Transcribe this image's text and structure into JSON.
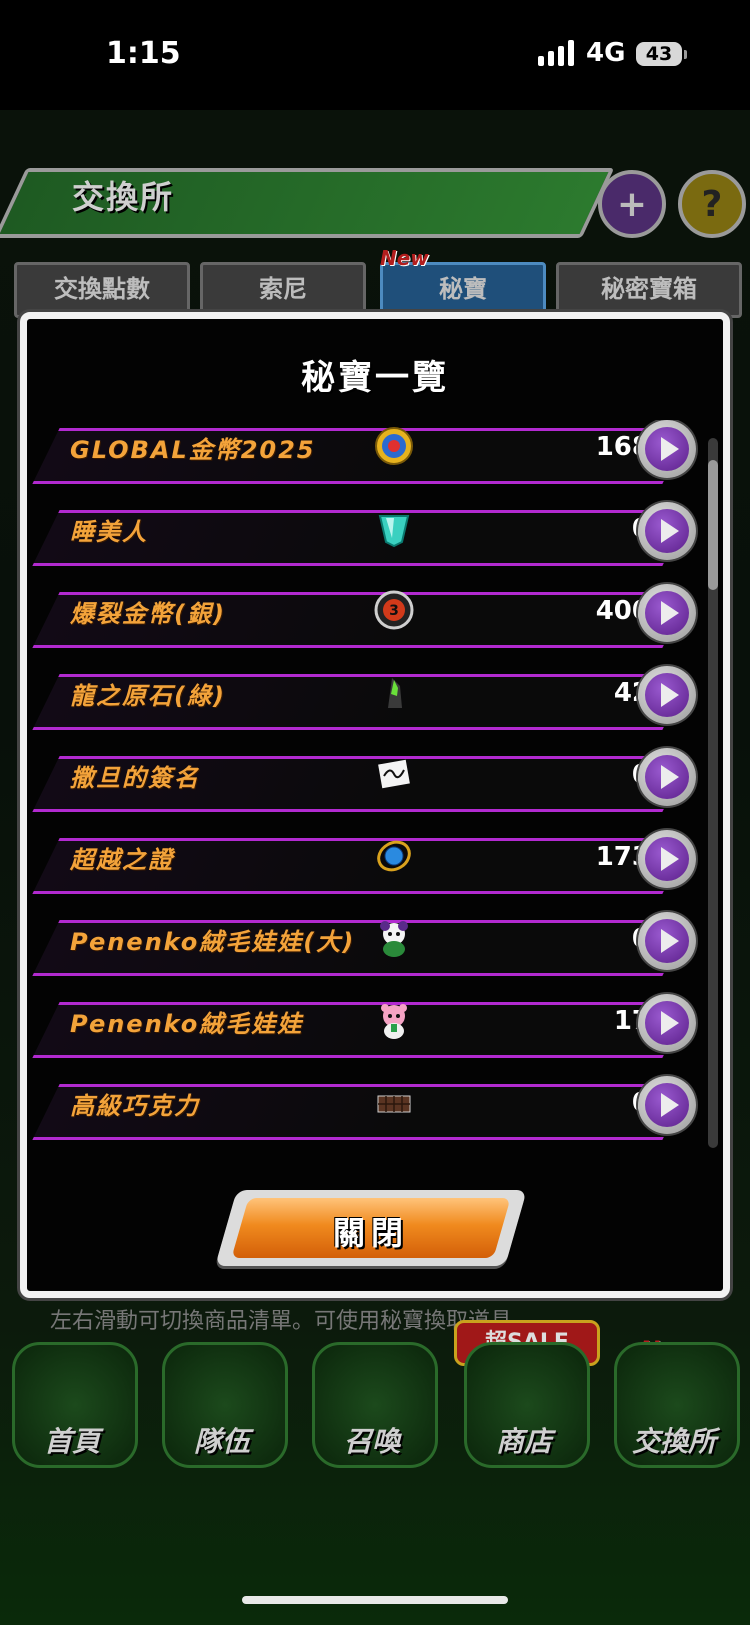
{
  "status_bar": {
    "time": "1:15",
    "network": "4G",
    "battery": "43"
  },
  "header": {
    "title": "交換所"
  },
  "tabs": [
    {
      "label": "交換點數",
      "active": false
    },
    {
      "label": "索尼",
      "active": false
    },
    {
      "label": "秘寶",
      "active": true,
      "badge": "New"
    },
    {
      "label": "秘密寶箱",
      "active": false
    }
  ],
  "dialog": {
    "title": "秘寶一覽",
    "items": [
      {
        "name": "GLOBAL金幣2025",
        "count": "168",
        "icon": "global-coin-icon"
      },
      {
        "name": "睡美人",
        "count": "0",
        "icon": "crystal-icon"
      },
      {
        "name": "爆裂金幣(銀)",
        "count": "400",
        "icon": "silver-coin-icon"
      },
      {
        "name": "龍之原石(綠)",
        "count": "42",
        "icon": "green-ore-icon"
      },
      {
        "name": "撒旦的簽名",
        "count": "0",
        "icon": "signature-card-icon"
      },
      {
        "name": "超越之證",
        "count": "173",
        "icon": "blue-medal-icon"
      },
      {
        "name": "Penenko絨毛娃娃(大)",
        "count": "0",
        "icon": "panda-plush-icon"
      },
      {
        "name": "Penenko絨毛娃娃",
        "count": "17",
        "icon": "pink-plush-icon"
      },
      {
        "name": "高級巧克力",
        "count": "0",
        "icon": "chocolate-icon"
      }
    ],
    "close_label": "關閉"
  },
  "bottom": {
    "hint": "左右滑動可切換商品清單。可使用秘寶換取道具。",
    "sale_badge": "超SALE",
    "new_badge": "New",
    "nav": [
      {
        "label": "首頁"
      },
      {
        "label": "隊伍"
      },
      {
        "label": "召喚"
      },
      {
        "label": "商店"
      },
      {
        "label": "交換所"
      }
    ]
  },
  "colors": {
    "accent_purple": "#b22ad0",
    "item_name_orange": "#f3a33a",
    "close_button_orange": "#f08a1e"
  }
}
